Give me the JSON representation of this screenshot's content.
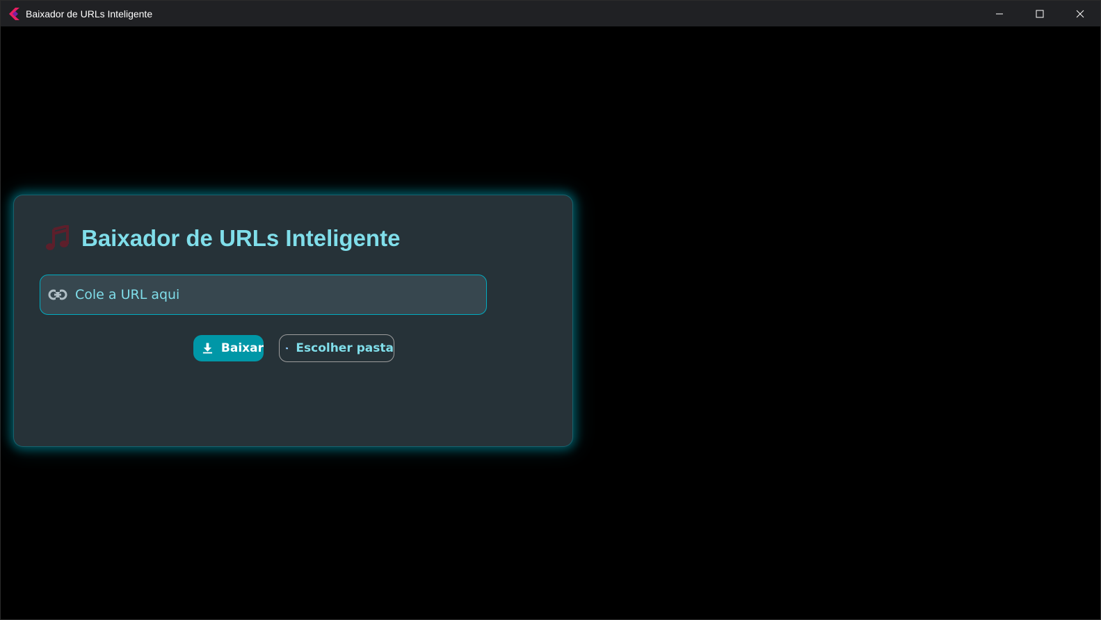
{
  "window": {
    "title": "Baixador de URLs Inteligente"
  },
  "card": {
    "title": "Baixador de URLs Inteligente",
    "title_icon": "music-note-icon"
  },
  "url_field": {
    "icon": "link-icon",
    "placeholder": "Cole a URL aqui",
    "value": ""
  },
  "buttons": {
    "download_label": "Baixar",
    "download_icon": "download-icon",
    "folder_label": "Escolher pasta",
    "folder_icon": "folder-icon"
  },
  "colors": {
    "background": "#000000",
    "card": "#263238",
    "accent": "#00acc1",
    "title_text": "#80deea",
    "primary_button": "#0097a7",
    "music_icon": "#5d1f2b",
    "folder_icon": "#90caf9"
  }
}
